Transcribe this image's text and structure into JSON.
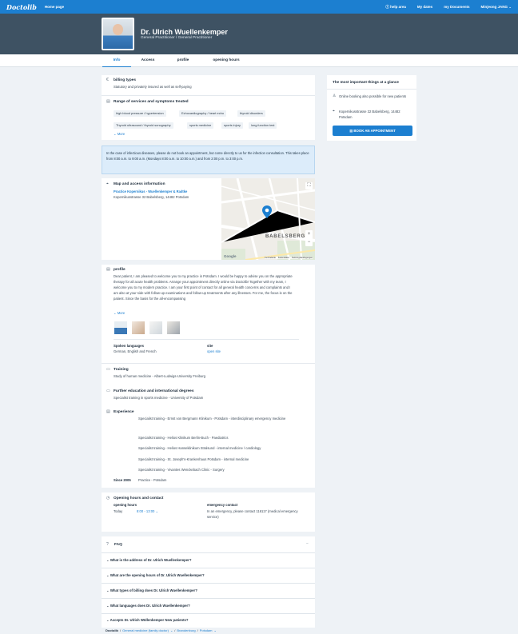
{
  "topbar": {
    "logo": "Doctolib",
    "home": "Home page",
    "nav": [
      "help area",
      "My dates",
      "my Documents",
      "Minjeong JANG"
    ]
  },
  "doctor": {
    "name": "Dr. Ulrich Wuellenkemper",
    "specialty": "General Practitioner / General Practitioner"
  },
  "tabs": [
    "Info",
    "Access",
    "profile",
    "opening hours"
  ],
  "billing": {
    "title": "billing types",
    "text": "Statutory and privately insured as well as self-paying"
  },
  "services": {
    "title": "Range of services and symptoms treated",
    "chips": [
      "high blood pressure / hypertension",
      "Echocardiography / heart echo",
      "thyroid disorders",
      "Thyroid ultrasound / thyroid sonography",
      "sports medicine",
      "sports injury",
      "lung function test"
    ],
    "more": "More"
  },
  "notice": "In the case of infectious diseases, please do not book an appointment, but come directly to us for the infection consultation. This takes place from 8:00 a.m. to 9:00 a.m. (Mondays 8:00 a.m. to 10:00 a.m.) and from 2:00 p.m. to 3:00 p.m.",
  "map_info": {
    "title": "Map and access information",
    "practice": "Practice Kopernikus - Wuellenkemper & Radtke",
    "address": "Kopernikusstrasse 32 Babelsberg, 14482 Potsdam",
    "district": "BABELSBERG",
    "attribution": [
      "Kurzbefehle",
      "Kartendaten",
      "Nutzungsbedingungen"
    ],
    "google": "Google"
  },
  "profile": {
    "title": "profile",
    "text": "Dear patient, I am pleased to welcome you to my practice in Potsdam. I would be happy to advise you on the appropriate therapy for all acute health problems. Arrange your appointment directly online via Doctolib! Together with my team, I welcome you to my modern practice. I am your first point of contact for all general health concerns and complaints and I am also at your side with follow-up examinations and follow-up treatments after any illnesses. For me, the focus is on the patient. Since the basis for the all-encompassing",
    "more": "More",
    "languages_label": "Spoken languages",
    "languages_value": "German, English and French",
    "site_label": "site",
    "site_value": "open site"
  },
  "training": {
    "title": "Training",
    "text": "Study of human medicine - Albert-Ludwigs-University Freiburg"
  },
  "further": {
    "title": "Further education and international degrees",
    "text": "Specialist training in sports medicine - University of Potsdam"
  },
  "experience": {
    "title": "Experience",
    "items": [
      "Specialist training - Ernst von Bergmann Klinikum - Potsdam - interdisciplinary emergency medicine",
      "Specialist training - Helios Klinikum Berlin-Buch - Paediatrics",
      "Specialist training - Helios Hanseklinikum Stralsund - internal medicine / cardiology",
      "Specialist training - St. Joseph's-Krankenhaus Potsdam - internal medicine",
      "Specialist training - Vivantes Wenckebach Clinic - Surgery"
    ],
    "since_year": "Since 2005",
    "since_text": "Practice - Potsdam"
  },
  "hours": {
    "title": "Opening hours and contact",
    "label": "opening hours",
    "day": "Today",
    "time": "8:00 - 13:00",
    "emergency_label": "emergency contact",
    "emergency_text": "In an emergency, please contact 116117 (medical emergency service)"
  },
  "faq": {
    "title": "FAQ",
    "questions": [
      "What is the address of Dr. Ulrich Wuellenkemper?",
      "What are the opening hours of Dr. Ulrich Wuellenkemper?",
      "What types of billing does Dr. Ulrich Wuellenkemper?",
      "What languages does Dr. Ulrich Wuellenkemper?",
      "Accepts Dr. Ulrich Wüllenkemper New patients?"
    ]
  },
  "sidebar": {
    "title": "The most important things at a glance",
    "online": "Online booking also possible for new patients",
    "address": "Kopernikusstrasse 32 Babelsberg, 14482 Potsdam",
    "book": "BOOK AN APPOINTMENT"
  },
  "breadcrumb": [
    "Doctolib",
    "General medicine (family doctor)",
    "Brandenburg",
    "Potsdam"
  ],
  "colors": {
    "brand": "#1c7fd0",
    "hero": "#3e5263",
    "notice": "#dcecfa"
  }
}
